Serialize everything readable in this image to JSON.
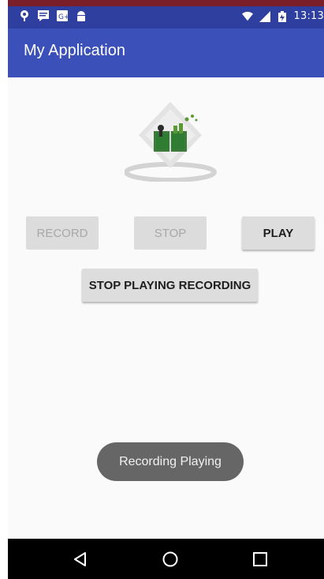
{
  "status_bar": {
    "time": "13:13",
    "left_icons": [
      "location-icon",
      "message-icon",
      "google-plus-icon",
      "android-icon"
    ],
    "right_icons": [
      "wifi-icon",
      "signal-icon",
      "battery-icon"
    ]
  },
  "app_bar": {
    "title": "My Application",
    "color": "#3b50b8"
  },
  "logo": {
    "icon": "tutorialspoint-logo"
  },
  "buttons": {
    "record": {
      "label": "RECORD",
      "enabled": false
    },
    "stop": {
      "label": "STOP",
      "enabled": false
    },
    "play": {
      "label": "PLAY",
      "enabled": true
    },
    "stop_playing": {
      "label": "STOP PLAYING RECORDING",
      "enabled": true
    }
  },
  "toast": {
    "text": "Recording Playing"
  },
  "nav_bar": {
    "icons": [
      "back-icon",
      "home-icon",
      "recents-icon"
    ]
  },
  "colors": {
    "status_bar": "#2f3fa0",
    "app_bar": "#3b50b8",
    "toast": "#666666",
    "logo_green": "#2e7d32"
  }
}
